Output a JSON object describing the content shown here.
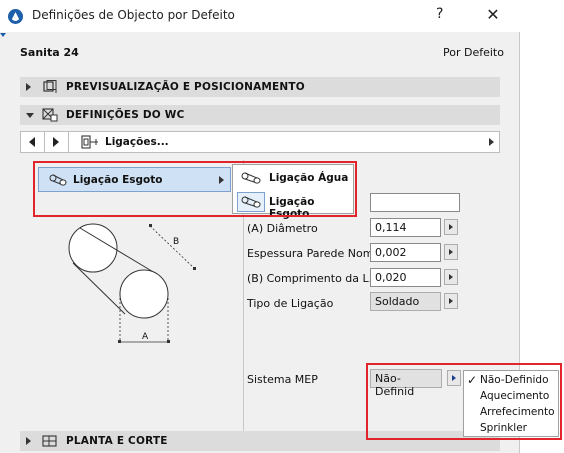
{
  "window": {
    "title": "Definições de Objecto por Defeito",
    "help": "?",
    "close": "✕"
  },
  "object": {
    "name": "Sanita 24",
    "default_label": "Por Defeito"
  },
  "sections": {
    "preview": "PREVISUALIZAÇÃO E POSICIONAMENTO",
    "wc": "DEFINIÇÕES DO WC",
    "plan": "PLANTA E CORTE"
  },
  "nav": {
    "label": "Ligações..."
  },
  "menu": {
    "main_item": "Ligação Esgoto",
    "sub_items": [
      "Ligação Água",
      "Ligação Esgoto"
    ]
  },
  "diagram": {
    "label_a": "A",
    "label_b": "B"
  },
  "params": {
    "name_value": "",
    "diameter_label": "(A) Diâmetro",
    "diameter_value": "0,114",
    "wall_label": "Espessura Parede Nom...",
    "wall_value": "0,002",
    "length_label": "(B) Comprimento da L...",
    "length_value": "0,020",
    "type_label": "Tipo de Ligação",
    "type_value": "Soldado",
    "mep_label": "Sistema MEP",
    "mep_value": "Não-Definid"
  },
  "mep_options": [
    "Não-Definido",
    "Aquecimento",
    "Arrefecimento",
    "Sprinkler"
  ],
  "mep_selected": "Não-Definido",
  "colors": {
    "highlight": "#e0262a",
    "menu_selected": "#cfe1f5",
    "brand": "#1d5fa8"
  }
}
